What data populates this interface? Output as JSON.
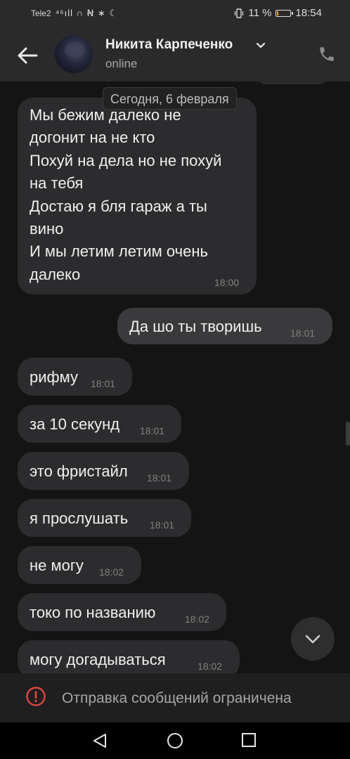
{
  "status_bar": {
    "carrier": "Tele2",
    "icons": "⁴⁶ıll ∩ Ꞥ ∗ ☾",
    "vibrate_icon": "vibrate-icon",
    "battery_percent": "11 %",
    "battery_level": 0.11,
    "time": "18:54"
  },
  "header": {
    "contact_name": "Никита Карпеченко",
    "contact_status": "online"
  },
  "chat": {
    "date_separator": "Сегодня, 6 февраля",
    "messages": [
      {
        "direction": "in",
        "text": "Мы бежим далеко не\nдогонит на не кто\nПохуй на дела но не похуй\nна тебя\nДостаю я бля гараж а ты\nвино\nИ мы летим летим очень\nдалеко",
        "time": "18:00"
      },
      {
        "direction": "out",
        "text": "Да шо ты творишь",
        "time": "18:01"
      },
      {
        "direction": "in",
        "text": "рифму",
        "time": "18:01"
      },
      {
        "direction": "in",
        "text": "за 10 секунд",
        "time": "18:01"
      },
      {
        "direction": "in",
        "text": "это фристайл",
        "time": "18:01"
      },
      {
        "direction": "in",
        "text": "я прослушать",
        "time": "18:01"
      },
      {
        "direction": "in",
        "text": "не могу",
        "time": "18:02"
      },
      {
        "direction": "in",
        "text": "токо по названию",
        "time": "18:02"
      },
      {
        "direction": "in",
        "text": "могу догадываться",
        "time": "18:02"
      }
    ]
  },
  "restriction": {
    "text": "Отправка сообщений ограничена"
  },
  "colors": {
    "background": "#141414",
    "bar": "#2a2a2a",
    "bubble_in": "#2c2c2e",
    "bubble_out": "#3a3a3c",
    "warning": "#e0463c"
  }
}
